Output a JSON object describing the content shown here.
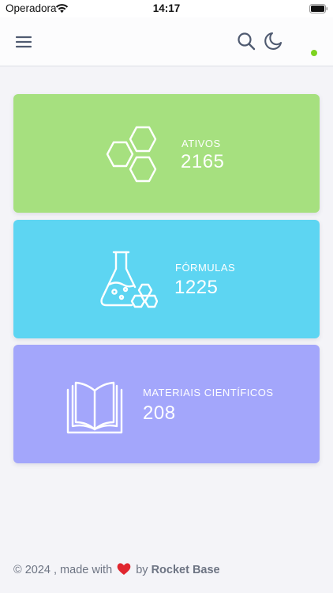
{
  "status_bar": {
    "carrier": "Operadora",
    "time": "14:17"
  },
  "header": {
    "icons": [
      "menu-icon",
      "search-icon",
      "moon-icon"
    ],
    "online_indicator_color": "#7ed321"
  },
  "cards": [
    {
      "label": "ATIVOS",
      "value": "2165",
      "icon": "hexagons-icon",
      "color": "#a6e07f"
    },
    {
      "label": "FÓRMULAS",
      "value": "1225",
      "icon": "flask-icon",
      "color": "#5dd5f2"
    },
    {
      "label": "MATERIAIS CIENTÍFICOS",
      "value": "208",
      "icon": "book-icon",
      "color": "#a3a6fb"
    }
  ],
  "footer": {
    "prefix": "© 2024 , made with",
    "by": "by",
    "brand": "Rocket Base",
    "heart_color": "#e0262f"
  }
}
